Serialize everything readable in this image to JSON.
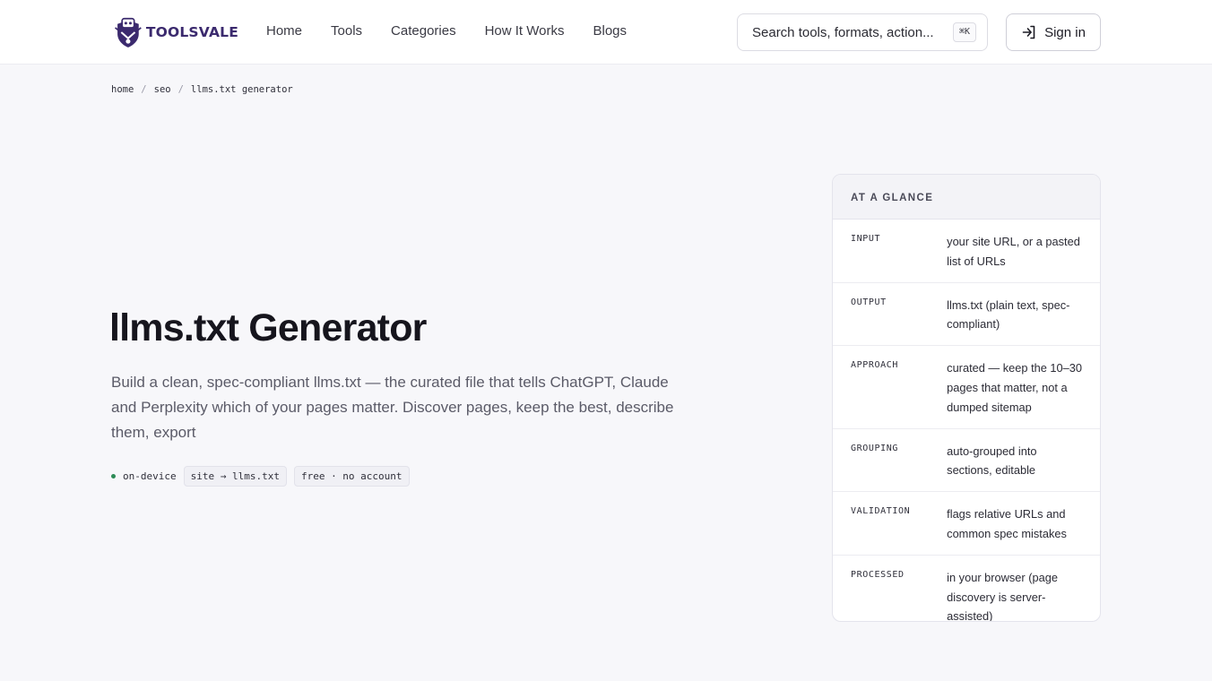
{
  "brand": {
    "name": "TOOLSVALE"
  },
  "nav": {
    "items": [
      "Home",
      "Tools",
      "Categories",
      "How It Works",
      "Blogs"
    ]
  },
  "search": {
    "placeholder": "Search tools, formats, action...",
    "shortcut": "⌘K"
  },
  "auth": {
    "signin_label": "Sign in"
  },
  "breadcrumb": {
    "items": [
      "home",
      "seo",
      "llms.txt generator"
    ],
    "separator": "/"
  },
  "hero": {
    "title": "llms.txt Generator",
    "description": "Build a clean, spec-compliant llms.txt — the curated file that tells ChatGPT, Claude and Perplexity which of your pages matter. Discover pages, keep the best, describe them, export",
    "tags": {
      "status": "on-device",
      "conversion": "site → llms.txt",
      "pricing": "free · no account"
    }
  },
  "glance": {
    "heading": "AT A GLANCE",
    "rows": [
      {
        "key": "INPUT",
        "value": "your site URL, or a pasted list of URLs"
      },
      {
        "key": "OUTPUT",
        "value": "llms.txt (plain text, spec-compliant)"
      },
      {
        "key": "APPROACH",
        "value": "curated — keep the 10–30 pages that matter, not a dumped sitemap"
      },
      {
        "key": "GROUPING",
        "value": "auto-grouped into sections, editable"
      },
      {
        "key": "VALIDATION",
        "value": "flags relative URLs and common spec mistakes"
      },
      {
        "key": "PROCESSED",
        "value": "in your browser (page discovery is server-assisted)"
      }
    ]
  },
  "colors": {
    "accent": "#3b2a6e",
    "status_dot": "#2e8b57",
    "background": "#f7f7fa"
  },
  "icons": {
    "logo": "robot-shield-logo-icon",
    "signin": "sign-in-icon"
  }
}
